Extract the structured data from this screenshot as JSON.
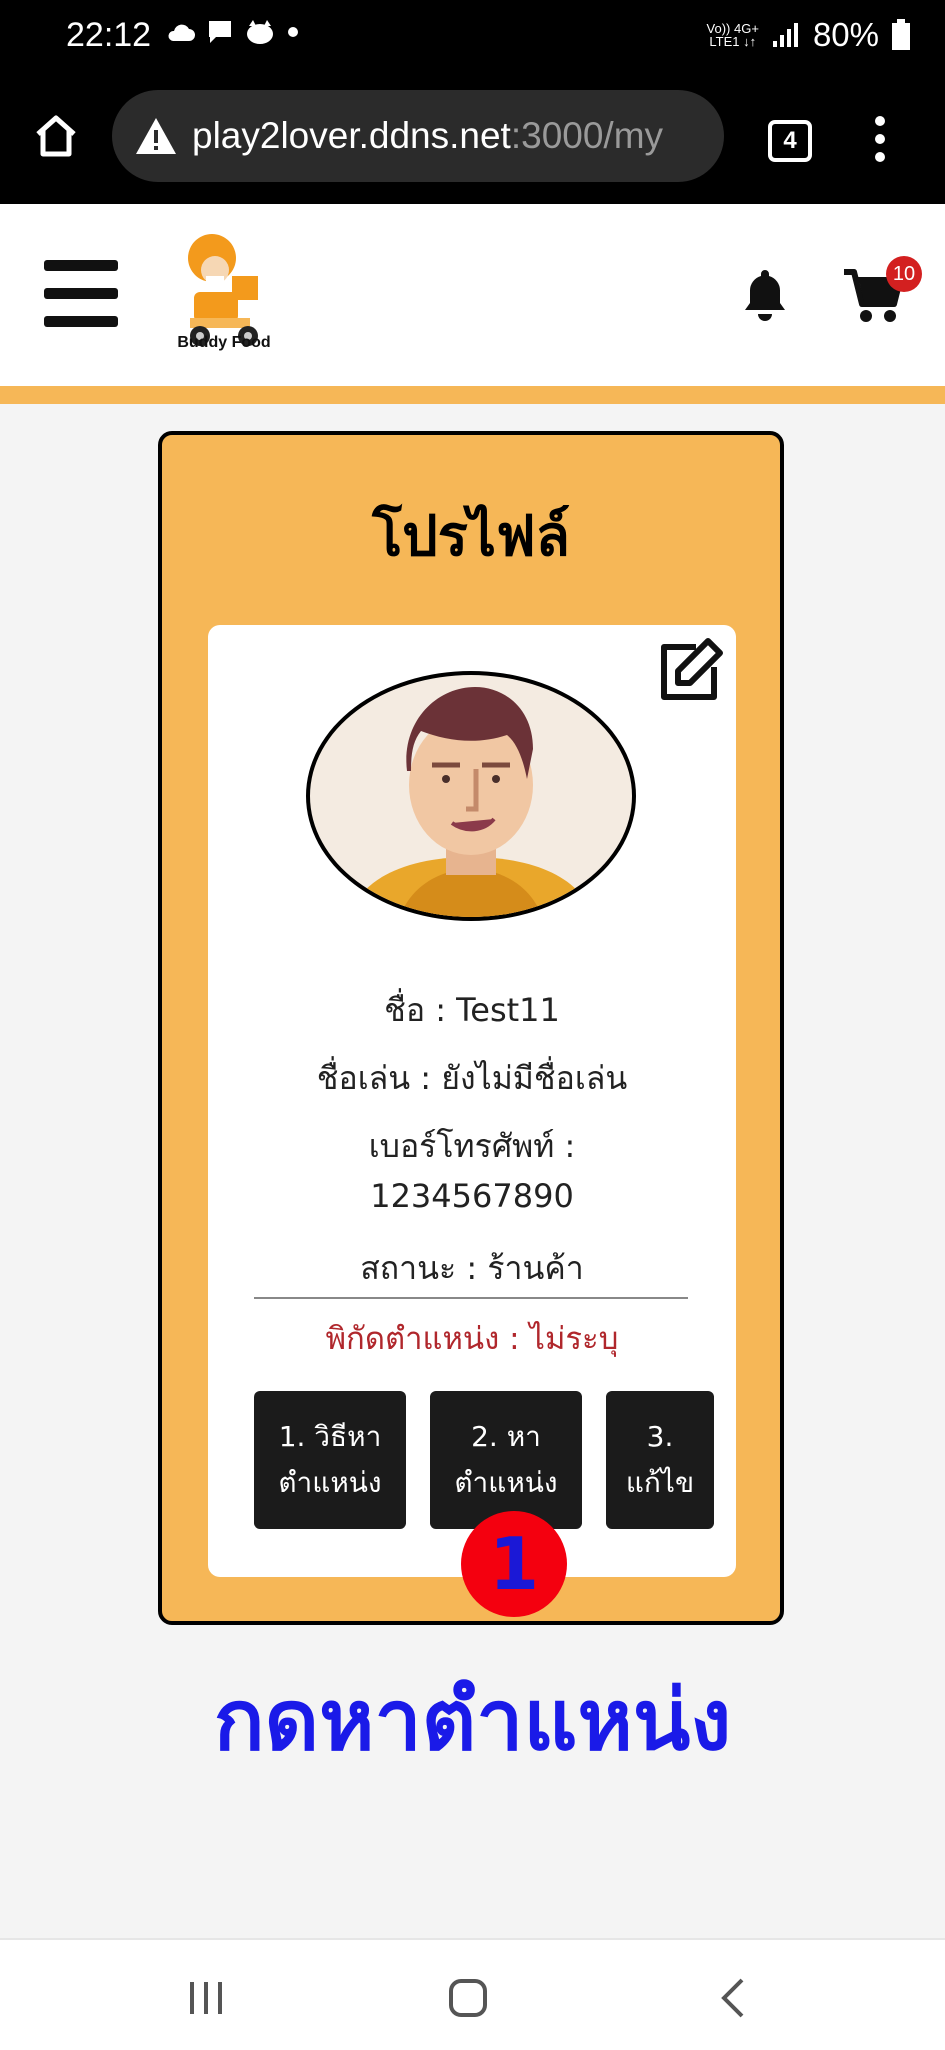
{
  "status_bar": {
    "time": "22:12",
    "network_top": "Vo)) 4G+",
    "network_bottom": "LTE1 ↓↑",
    "battery": "80%"
  },
  "browser": {
    "url_host": "play2lover.ddns.net",
    "url_rest": ":3000/my",
    "tab_count": "4"
  },
  "header": {
    "logo_text": "Buddy Food",
    "cart_count": "10"
  },
  "profile": {
    "title": "โปรไฟล์",
    "name": "ชื่อ : Test11",
    "nickname": "ชื่อเล่น : ยังไม่มีชื่อเล่น",
    "phone_label": "เบอร์โทรศัพท์ :",
    "phone_value": "1234567890",
    "status": "สถานะ : ร้านค้า",
    "coords": "พิกัดตำแหน่ง : ไม่ระบุ",
    "buttons": [
      {
        "line1": "1. วิธีหา",
        "line2": "ตำแหน่ง"
      },
      {
        "line1": "2. หา",
        "line2": "ตำแหน่ง"
      },
      {
        "line1": "3.",
        "line2": "แก้ไข"
      }
    ]
  },
  "annotation": {
    "step_number": "1",
    "caption": "กดหาตำแหน่ง"
  },
  "colors": {
    "accent": "#f6b757",
    "button_bg": "#1b1b1b",
    "coords_text": "#b0272c",
    "caption": "#1a1ae8",
    "badge": "#f4000f"
  },
  "icons": {
    "home": "home-icon",
    "warning": "warning-icon",
    "menu": "more-vert-icon",
    "hamburger": "hamburger-icon",
    "bell": "bell-icon",
    "cart": "cart-icon",
    "edit": "edit-icon"
  }
}
